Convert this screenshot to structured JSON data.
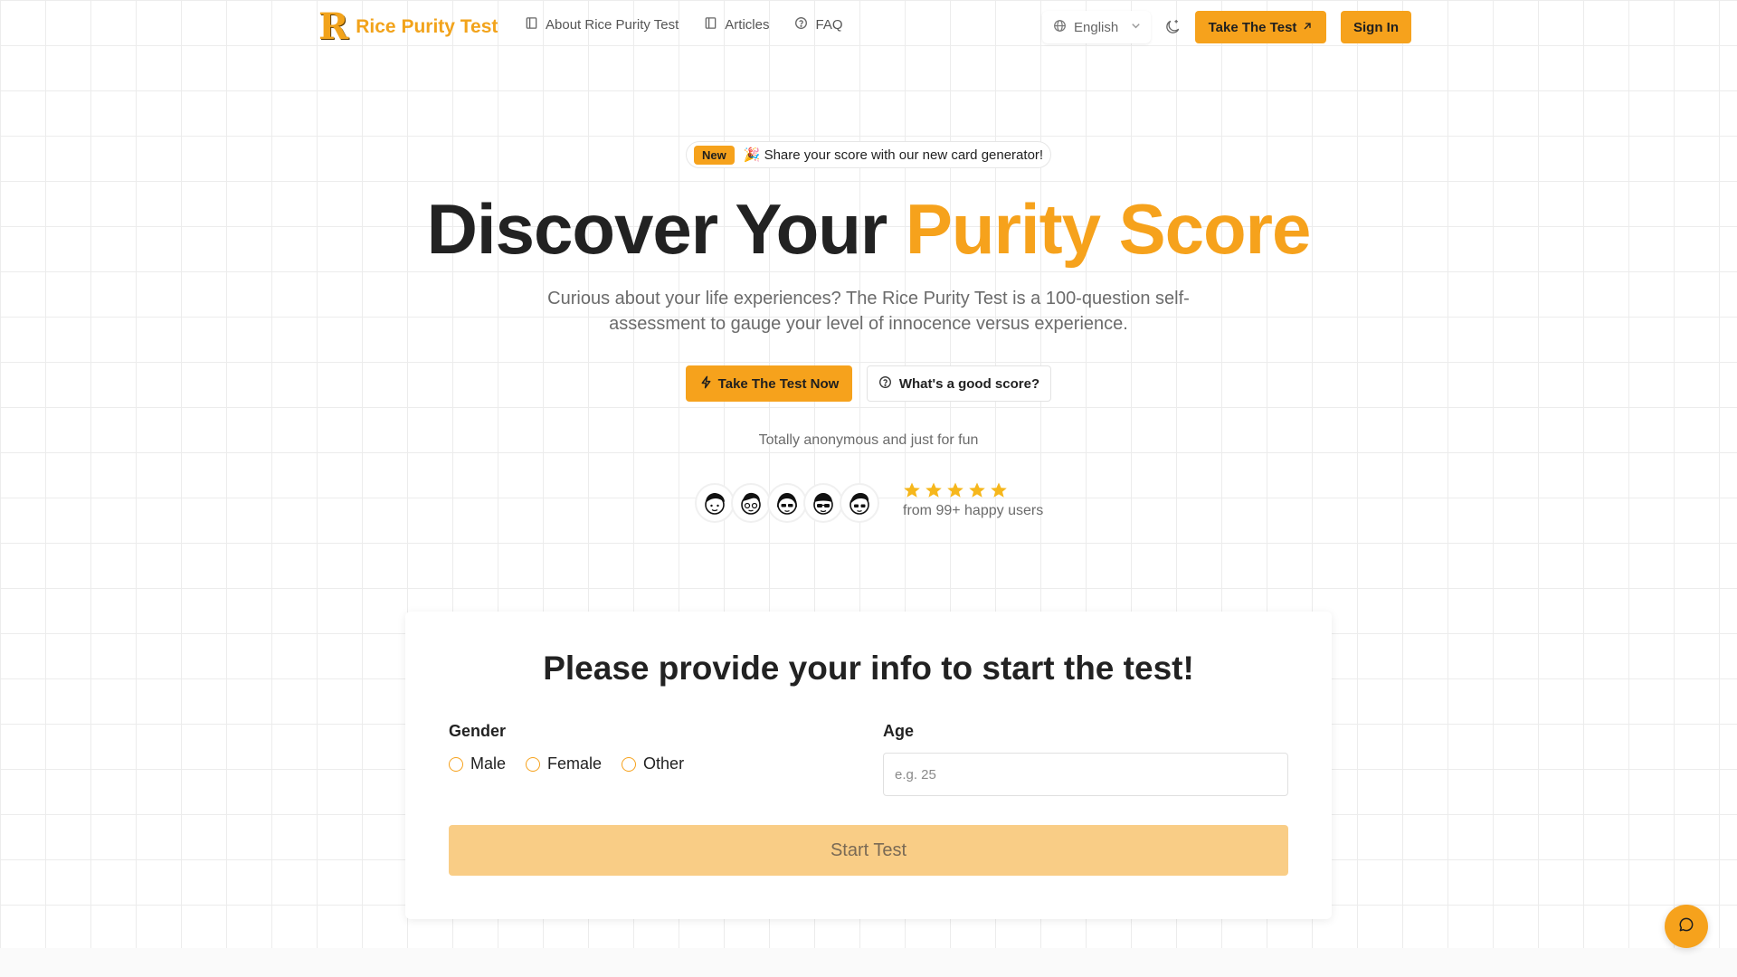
{
  "header": {
    "logo_mark": "R",
    "logo_text": "Rice Purity Test",
    "nav": [
      {
        "label": "About Rice Purity Test",
        "icon": "book-icon"
      },
      {
        "label": "Articles",
        "icon": "book-icon"
      },
      {
        "label": "FAQ",
        "icon": "help-circle-icon"
      }
    ],
    "language": "English",
    "take_test_label": "Take The Test",
    "sign_in_label": "Sign In"
  },
  "hero": {
    "badge": "New",
    "announcement": "🎉 Share your score with our new card generator!",
    "title_plain": "Discover Your ",
    "title_accent": "Purity Score",
    "subtitle": "Curious about your life experiences? The Rice Purity Test is a 100-question self-assessment to gauge your level of innocence versus experience.",
    "cta_primary": "Take The Test Now",
    "cta_secondary": "What's a good score?",
    "anonymous_note": "Totally anonymous and just for fun",
    "rating_stars": 5,
    "happy_users": "from 99+ happy users"
  },
  "form": {
    "title": "Please provide your info to start the test!",
    "gender_label": "Gender",
    "gender_options": [
      "Male",
      "Female",
      "Other"
    ],
    "age_label": "Age",
    "age_placeholder": "e.g. 25",
    "age_value": "",
    "start_label": "Start Test"
  },
  "colors": {
    "accent": "#f6a21c",
    "start_disabled": "#f9cd86"
  }
}
